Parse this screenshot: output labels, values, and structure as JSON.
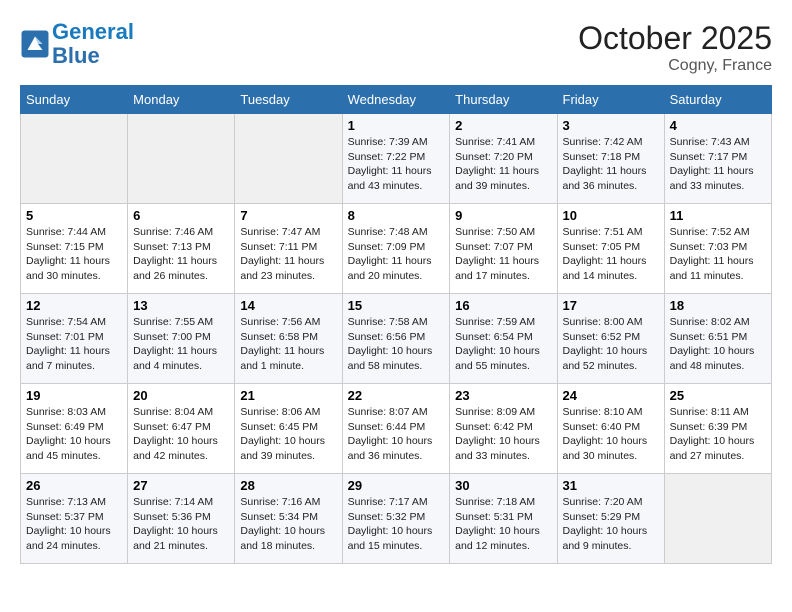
{
  "header": {
    "logo_line1": "General",
    "logo_line2": "Blue",
    "month": "October 2025",
    "location": "Cogny, France"
  },
  "days_of_week": [
    "Sunday",
    "Monday",
    "Tuesday",
    "Wednesday",
    "Thursday",
    "Friday",
    "Saturday"
  ],
  "weeks": [
    [
      {
        "num": "",
        "sunrise": "",
        "sunset": "",
        "daylight": ""
      },
      {
        "num": "",
        "sunrise": "",
        "sunset": "",
        "daylight": ""
      },
      {
        "num": "",
        "sunrise": "",
        "sunset": "",
        "daylight": ""
      },
      {
        "num": "1",
        "sunrise": "Sunrise: 7:39 AM",
        "sunset": "Sunset: 7:22 PM",
        "daylight": "Daylight: 11 hours and 43 minutes."
      },
      {
        "num": "2",
        "sunrise": "Sunrise: 7:41 AM",
        "sunset": "Sunset: 7:20 PM",
        "daylight": "Daylight: 11 hours and 39 minutes."
      },
      {
        "num": "3",
        "sunrise": "Sunrise: 7:42 AM",
        "sunset": "Sunset: 7:18 PM",
        "daylight": "Daylight: 11 hours and 36 minutes."
      },
      {
        "num": "4",
        "sunrise": "Sunrise: 7:43 AM",
        "sunset": "Sunset: 7:17 PM",
        "daylight": "Daylight: 11 hours and 33 minutes."
      }
    ],
    [
      {
        "num": "5",
        "sunrise": "Sunrise: 7:44 AM",
        "sunset": "Sunset: 7:15 PM",
        "daylight": "Daylight: 11 hours and 30 minutes."
      },
      {
        "num": "6",
        "sunrise": "Sunrise: 7:46 AM",
        "sunset": "Sunset: 7:13 PM",
        "daylight": "Daylight: 11 hours and 26 minutes."
      },
      {
        "num": "7",
        "sunrise": "Sunrise: 7:47 AM",
        "sunset": "Sunset: 7:11 PM",
        "daylight": "Daylight: 11 hours and 23 minutes."
      },
      {
        "num": "8",
        "sunrise": "Sunrise: 7:48 AM",
        "sunset": "Sunset: 7:09 PM",
        "daylight": "Daylight: 11 hours and 20 minutes."
      },
      {
        "num": "9",
        "sunrise": "Sunrise: 7:50 AM",
        "sunset": "Sunset: 7:07 PM",
        "daylight": "Daylight: 11 hours and 17 minutes."
      },
      {
        "num": "10",
        "sunrise": "Sunrise: 7:51 AM",
        "sunset": "Sunset: 7:05 PM",
        "daylight": "Daylight: 11 hours and 14 minutes."
      },
      {
        "num": "11",
        "sunrise": "Sunrise: 7:52 AM",
        "sunset": "Sunset: 7:03 PM",
        "daylight": "Daylight: 11 hours and 11 minutes."
      }
    ],
    [
      {
        "num": "12",
        "sunrise": "Sunrise: 7:54 AM",
        "sunset": "Sunset: 7:01 PM",
        "daylight": "Daylight: 11 hours and 7 minutes."
      },
      {
        "num": "13",
        "sunrise": "Sunrise: 7:55 AM",
        "sunset": "Sunset: 7:00 PM",
        "daylight": "Daylight: 11 hours and 4 minutes."
      },
      {
        "num": "14",
        "sunrise": "Sunrise: 7:56 AM",
        "sunset": "Sunset: 6:58 PM",
        "daylight": "Daylight: 11 hours and 1 minute."
      },
      {
        "num": "15",
        "sunrise": "Sunrise: 7:58 AM",
        "sunset": "Sunset: 6:56 PM",
        "daylight": "Daylight: 10 hours and 58 minutes."
      },
      {
        "num": "16",
        "sunrise": "Sunrise: 7:59 AM",
        "sunset": "Sunset: 6:54 PM",
        "daylight": "Daylight: 10 hours and 55 minutes."
      },
      {
        "num": "17",
        "sunrise": "Sunrise: 8:00 AM",
        "sunset": "Sunset: 6:52 PM",
        "daylight": "Daylight: 10 hours and 52 minutes."
      },
      {
        "num": "18",
        "sunrise": "Sunrise: 8:02 AM",
        "sunset": "Sunset: 6:51 PM",
        "daylight": "Daylight: 10 hours and 48 minutes."
      }
    ],
    [
      {
        "num": "19",
        "sunrise": "Sunrise: 8:03 AM",
        "sunset": "Sunset: 6:49 PM",
        "daylight": "Daylight: 10 hours and 45 minutes."
      },
      {
        "num": "20",
        "sunrise": "Sunrise: 8:04 AM",
        "sunset": "Sunset: 6:47 PM",
        "daylight": "Daylight: 10 hours and 42 minutes."
      },
      {
        "num": "21",
        "sunrise": "Sunrise: 8:06 AM",
        "sunset": "Sunset: 6:45 PM",
        "daylight": "Daylight: 10 hours and 39 minutes."
      },
      {
        "num": "22",
        "sunrise": "Sunrise: 8:07 AM",
        "sunset": "Sunset: 6:44 PM",
        "daylight": "Daylight: 10 hours and 36 minutes."
      },
      {
        "num": "23",
        "sunrise": "Sunrise: 8:09 AM",
        "sunset": "Sunset: 6:42 PM",
        "daylight": "Daylight: 10 hours and 33 minutes."
      },
      {
        "num": "24",
        "sunrise": "Sunrise: 8:10 AM",
        "sunset": "Sunset: 6:40 PM",
        "daylight": "Daylight: 10 hours and 30 minutes."
      },
      {
        "num": "25",
        "sunrise": "Sunrise: 8:11 AM",
        "sunset": "Sunset: 6:39 PM",
        "daylight": "Daylight: 10 hours and 27 minutes."
      }
    ],
    [
      {
        "num": "26",
        "sunrise": "Sunrise: 7:13 AM",
        "sunset": "Sunset: 5:37 PM",
        "daylight": "Daylight: 10 hours and 24 minutes."
      },
      {
        "num": "27",
        "sunrise": "Sunrise: 7:14 AM",
        "sunset": "Sunset: 5:36 PM",
        "daylight": "Daylight: 10 hours and 21 minutes."
      },
      {
        "num": "28",
        "sunrise": "Sunrise: 7:16 AM",
        "sunset": "Sunset: 5:34 PM",
        "daylight": "Daylight: 10 hours and 18 minutes."
      },
      {
        "num": "29",
        "sunrise": "Sunrise: 7:17 AM",
        "sunset": "Sunset: 5:32 PM",
        "daylight": "Daylight: 10 hours and 15 minutes."
      },
      {
        "num": "30",
        "sunrise": "Sunrise: 7:18 AM",
        "sunset": "Sunset: 5:31 PM",
        "daylight": "Daylight: 10 hours and 12 minutes."
      },
      {
        "num": "31",
        "sunrise": "Sunrise: 7:20 AM",
        "sunset": "Sunset: 5:29 PM",
        "daylight": "Daylight: 10 hours and 9 minutes."
      },
      {
        "num": "",
        "sunrise": "",
        "sunset": "",
        "daylight": ""
      }
    ]
  ]
}
